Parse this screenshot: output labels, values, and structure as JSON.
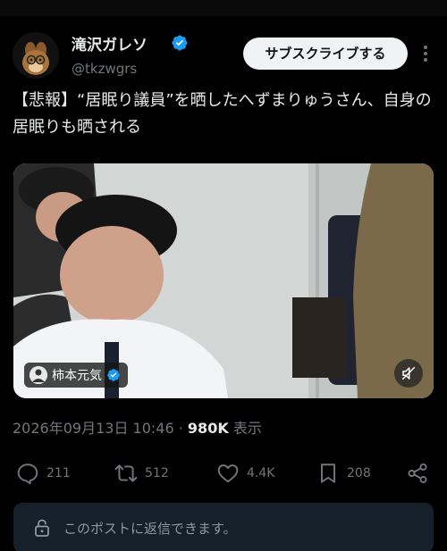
{
  "author": {
    "name": "滝沢ガレソ",
    "handle": "@tkzwgrs",
    "subscribe_label": "サブスクライブする"
  },
  "tweet": {
    "text": "【悲報】“居眠り議員”を晒したへずまりゅうさん、自身の居眠りも晒される"
  },
  "media": {
    "tag_name": "柿本元気"
  },
  "meta": {
    "datetime": "2026年09月13日 10:46",
    "separator": "·",
    "views_count": "980K",
    "views_label": "表示"
  },
  "actions": {
    "replies": "211",
    "reposts": "512",
    "likes": "4.4K",
    "bookmarks": "208"
  },
  "reply_notice": {
    "text": "このポストに返信できます。"
  },
  "colors": {
    "background": "#000000",
    "verified": "#1d9bf0",
    "muted_text": "#71767b",
    "reply_box": "#16202a"
  }
}
